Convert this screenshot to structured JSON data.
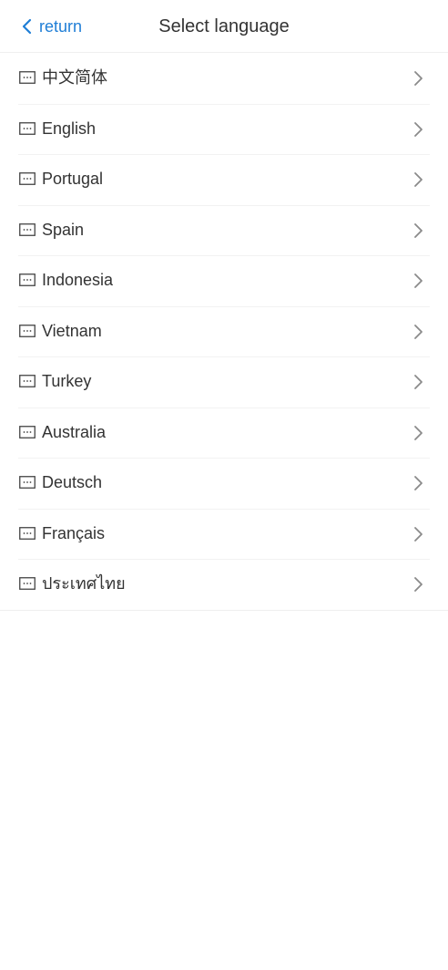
{
  "header": {
    "back_label": "return",
    "title": "Select language",
    "back_icon": "chevron-left-icon",
    "accent_color": "#1f7ed6"
  },
  "languages": [
    {
      "label": "中文简体",
      "icon": "flag-placeholder-icon"
    },
    {
      "label": "English",
      "icon": "flag-placeholder-icon"
    },
    {
      "label": "Portugal",
      "icon": "flag-placeholder-icon"
    },
    {
      "label": "Spain",
      "icon": "flag-placeholder-icon"
    },
    {
      "label": "Indonesia",
      "icon": "flag-placeholder-icon"
    },
    {
      "label": "Vietnam",
      "icon": "flag-placeholder-icon"
    },
    {
      "label": "Turkey",
      "icon": "flag-placeholder-icon"
    },
    {
      "label": "Australia",
      "icon": "flag-placeholder-icon"
    },
    {
      "label": "Deutsch",
      "icon": "flag-placeholder-icon"
    },
    {
      "label": "Français",
      "icon": "flag-placeholder-icon"
    },
    {
      "label": "ประเทศไทย",
      "icon": "flag-placeholder-icon"
    }
  ],
  "row_icon": "chevron-right-icon"
}
